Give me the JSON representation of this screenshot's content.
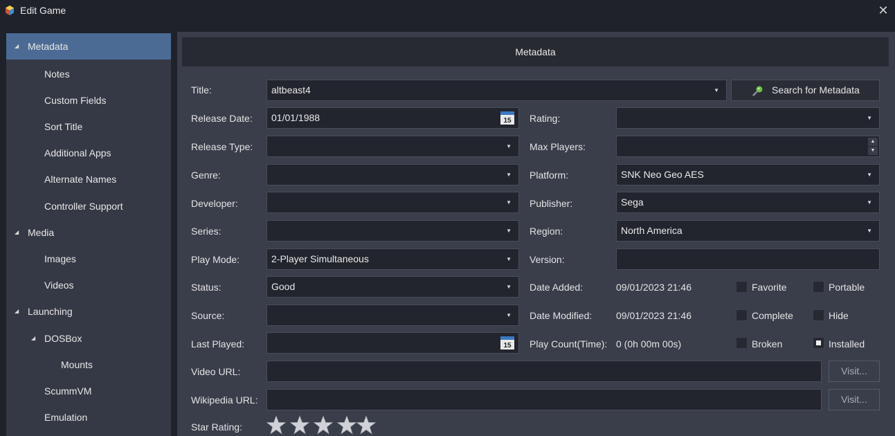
{
  "window": {
    "title": "Edit Game"
  },
  "sidebar": {
    "items": [
      {
        "label": "Metadata"
      },
      {
        "label": "Notes"
      },
      {
        "label": "Custom Fields"
      },
      {
        "label": "Sort Title"
      },
      {
        "label": "Additional Apps"
      },
      {
        "label": "Alternate Names"
      },
      {
        "label": "Controller Support"
      },
      {
        "label": "Media"
      },
      {
        "label": "Images"
      },
      {
        "label": "Videos"
      },
      {
        "label": "Launching"
      },
      {
        "label": "DOSBox"
      },
      {
        "label": "Mounts"
      },
      {
        "label": "ScummVM"
      },
      {
        "label": "Emulation"
      }
    ]
  },
  "header": {
    "title": "Metadata"
  },
  "form": {
    "title": {
      "label": "Title:",
      "value": "altbeast4"
    },
    "search_button": "Search for Metadata",
    "release_date": {
      "label": "Release Date:",
      "value": "01/01/1988"
    },
    "rating": {
      "label": "Rating:",
      "value": ""
    },
    "release_type": {
      "label": "Release Type:",
      "value": ""
    },
    "max_players": {
      "label": "Max Players:",
      "value": ""
    },
    "genre": {
      "label": "Genre:",
      "value": ""
    },
    "platform": {
      "label": "Platform:",
      "value": "SNK Neo Geo AES"
    },
    "developer": {
      "label": "Developer:",
      "value": ""
    },
    "publisher": {
      "label": "Publisher:",
      "value": "Sega"
    },
    "series": {
      "label": "Series:",
      "value": ""
    },
    "region": {
      "label": "Region:",
      "value": "North America"
    },
    "play_mode": {
      "label": "Play Mode:",
      "value": "2-Player Simultaneous"
    },
    "version": {
      "label": "Version:",
      "value": ""
    },
    "status": {
      "label": "Status:",
      "value": "Good"
    },
    "date_added": {
      "label": "Date Added:",
      "value": "09/01/2023 21:46"
    },
    "source": {
      "label": "Source:",
      "value": ""
    },
    "date_modified": {
      "label": "Date Modified:",
      "value": "09/01/2023 21:46"
    },
    "last_played": {
      "label": "Last Played:",
      "value": ""
    },
    "play_count": {
      "label": "Play Count(Time):",
      "value": "0 (0h 00m 00s)"
    },
    "video_url": {
      "label": "Video URL:",
      "value": ""
    },
    "wikipedia_url": {
      "label": "Wikipedia URL:",
      "value": ""
    },
    "visit_label": "Visit...",
    "star_rating": {
      "label": "Star Rating:",
      "value": 0,
      "max": 5
    },
    "calendar_day": "15"
  },
  "checkboxes": {
    "favorite": {
      "label": "Favorite",
      "checked": false
    },
    "portable": {
      "label": "Portable",
      "checked": false
    },
    "complete": {
      "label": "Complete",
      "checked": false
    },
    "hide": {
      "label": "Hide",
      "checked": false
    },
    "broken": {
      "label": "Broken",
      "checked": false
    },
    "installed": {
      "label": "Installed",
      "checked": true
    }
  },
  "colors": {
    "background": "#1f222b",
    "sidebar": "#353945",
    "selected": "#4b6b94",
    "panel": "#3a3e4b",
    "field": "#22252e"
  }
}
